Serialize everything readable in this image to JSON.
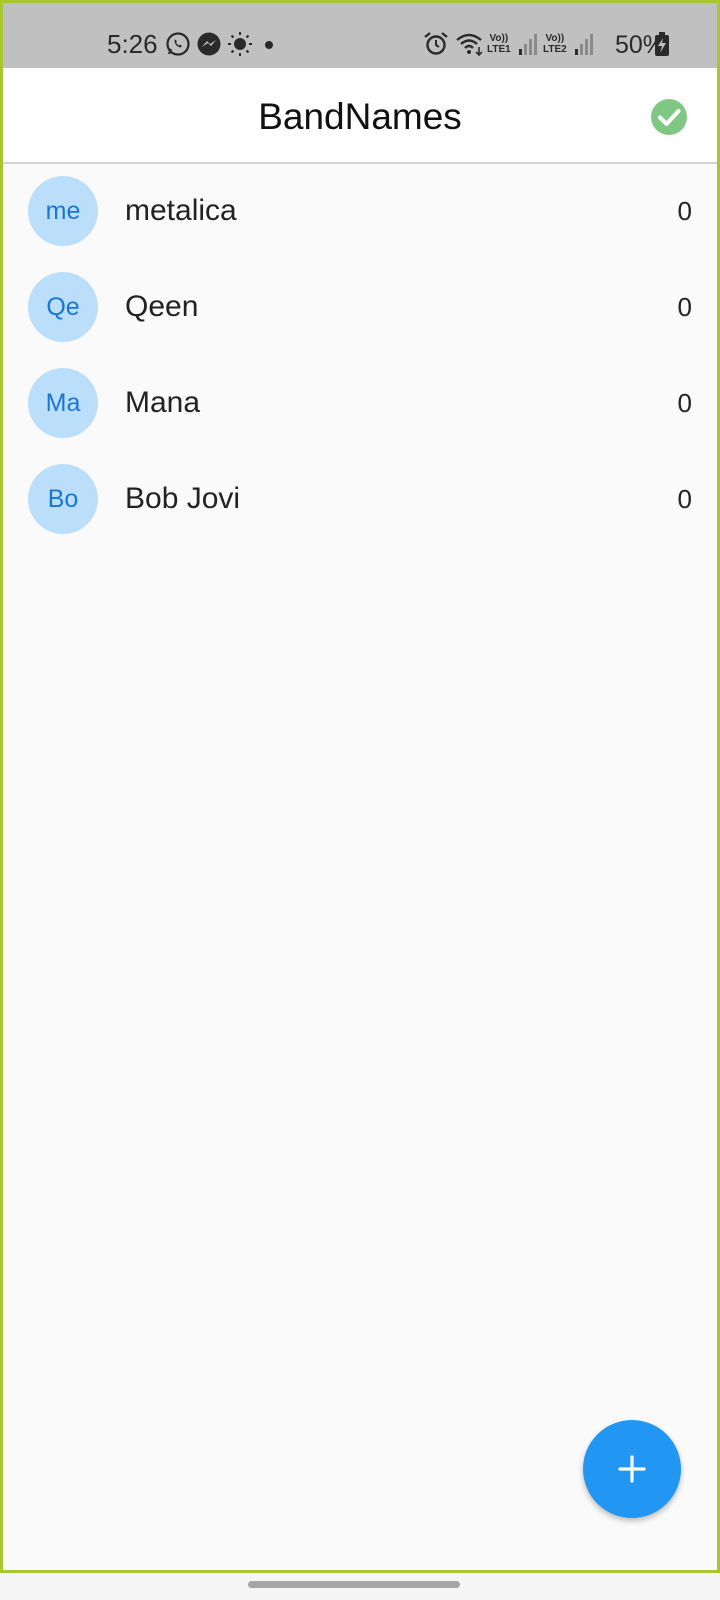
{
  "status_bar": {
    "time": "5:26",
    "lte1": "Vo))\nLTE1",
    "lte2": "Vo))\nLTE2",
    "battery": "50%"
  },
  "app_bar": {
    "title": "BandNames",
    "status_icon": "check-circle-icon",
    "status_color": "#81c784"
  },
  "bands": [
    {
      "initials": "me",
      "name": "metalica",
      "votes": "0"
    },
    {
      "initials": "Qe",
      "name": "Qeen",
      "votes": "0"
    },
    {
      "initials": "Ma",
      "name": "Mana",
      "votes": "0"
    },
    {
      "initials": "Bo",
      "name": "Bob Jovi",
      "votes": "0"
    }
  ],
  "fab": {
    "icon": "plus-icon",
    "color": "#2196f3"
  },
  "colors": {
    "avatar_bg": "#bbdefb",
    "avatar_text": "#1976d2"
  }
}
